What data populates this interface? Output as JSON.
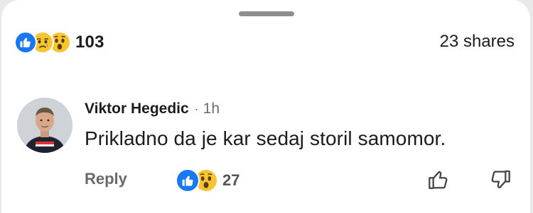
{
  "reaction_summary": {
    "icons": [
      "like-icon",
      "sad-icon",
      "wow-icon"
    ],
    "count": "103"
  },
  "shares_label": "23 shares",
  "comment": {
    "author": "Viktor Hegedic",
    "separator": "·",
    "time": "1h",
    "text": "Prikladno da je kar sedaj storil samomor.",
    "reply_label": "Reply",
    "reactions": {
      "icons": [
        "like-icon",
        "wow-icon"
      ],
      "count": "27"
    }
  },
  "colors": {
    "like_blue": "#1877f2",
    "emoji_yellow": "#f7c531",
    "muted_text": "#6a6a6a"
  }
}
